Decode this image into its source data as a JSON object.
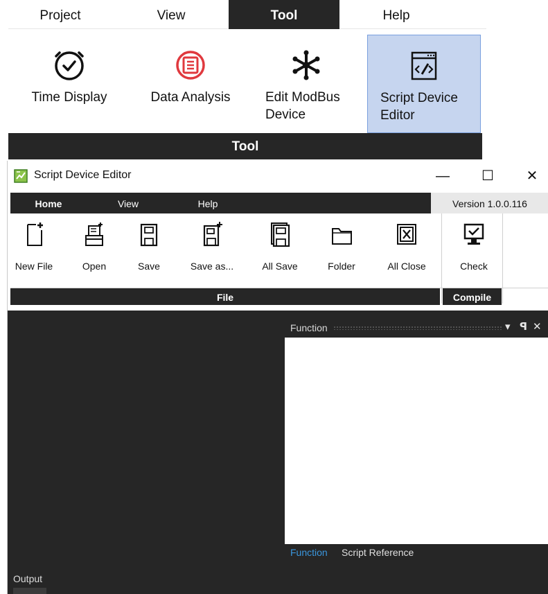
{
  "main_menu": {
    "tabs": [
      {
        "label": "Project",
        "active": false
      },
      {
        "label": "View",
        "active": false
      },
      {
        "label": "Tool",
        "active": true
      },
      {
        "label": "Help",
        "active": false
      }
    ]
  },
  "main_ribbon": {
    "buttons": [
      {
        "label": "Time Display",
        "icon": "clock-icon",
        "selected": false
      },
      {
        "label": "Data Analysis",
        "icon": "list-circle-icon",
        "selected": false
      },
      {
        "label": "Edit ModBus\nDevice",
        "icon": "asterisk-icon",
        "selected": false
      },
      {
        "label": "Script Device\nEditor",
        "icon": "script-editor-icon",
        "selected": true
      }
    ],
    "group_label": "Tool"
  },
  "editor_window": {
    "title": "Script Device Editor",
    "controls": {
      "minimize": "—",
      "maximize": "☐",
      "close": "✕"
    },
    "tabs": [
      {
        "label": "Home",
        "active": true
      },
      {
        "label": "View",
        "active": false
      },
      {
        "label": "Help",
        "active": false
      }
    ],
    "version": "Version 1.0.0.116",
    "file_group": {
      "label": "File",
      "buttons": [
        {
          "label": "New File",
          "icon": "new-file-icon"
        },
        {
          "label": "Open",
          "icon": "open-icon"
        },
        {
          "label": "Save",
          "icon": "save-icon"
        },
        {
          "label": "Save as...",
          "icon": "save-as-icon"
        },
        {
          "label": "All Save",
          "icon": "all-save-icon"
        },
        {
          "label": "Folder",
          "icon": "folder-icon"
        },
        {
          "label": "All Close",
          "icon": "all-close-icon"
        }
      ]
    },
    "compile_group": {
      "label": "Compile",
      "buttons": [
        {
          "label": "Check",
          "icon": "check-monitor-icon"
        }
      ]
    },
    "function_panel": {
      "title": "Function",
      "controls": {
        "dropdown": "▾",
        "pin": "ꟼ",
        "close": "✕"
      },
      "tabs": [
        {
          "label": "Function",
          "active": true
        },
        {
          "label": "Script Reference",
          "active": false
        }
      ]
    },
    "output_label": "Output"
  },
  "colors": {
    "dark_bar": "#262626",
    "selected_bg": "#c6d5ef",
    "selected_border": "#7aa0de",
    "data_analysis_red": "#e0393e",
    "active_panel_tab": "#3a96dd"
  }
}
